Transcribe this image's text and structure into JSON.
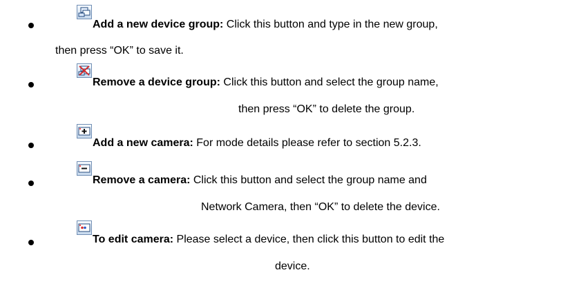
{
  "items": [
    {
      "icon": "add-device-group-icon",
      "heading": "Add a new device group:",
      "text": " Click this button and type in the new group,",
      "continuation": "then press “OK” to save it."
    },
    {
      "icon": "remove-device-group-icon",
      "heading": "Remove a device group:",
      "text": " Click this button and select the group name,",
      "continuation": "then press “OK” to delete the group."
    },
    {
      "icon": "add-camera-icon",
      "heading": "Add a new camera:",
      "text": " For mode details please refer to section 5.2.3."
    },
    {
      "icon": "remove-camera-icon",
      "heading": "Remove a camera:",
      "text": " Click this button and select the group name and",
      "continuation": "Network Camera, then “OK” to delete the device."
    },
    {
      "icon": "edit-camera-icon",
      "heading": "To edit camera:",
      "text": " Please select a device, then click this button to edit the",
      "continuation": "device."
    }
  ]
}
